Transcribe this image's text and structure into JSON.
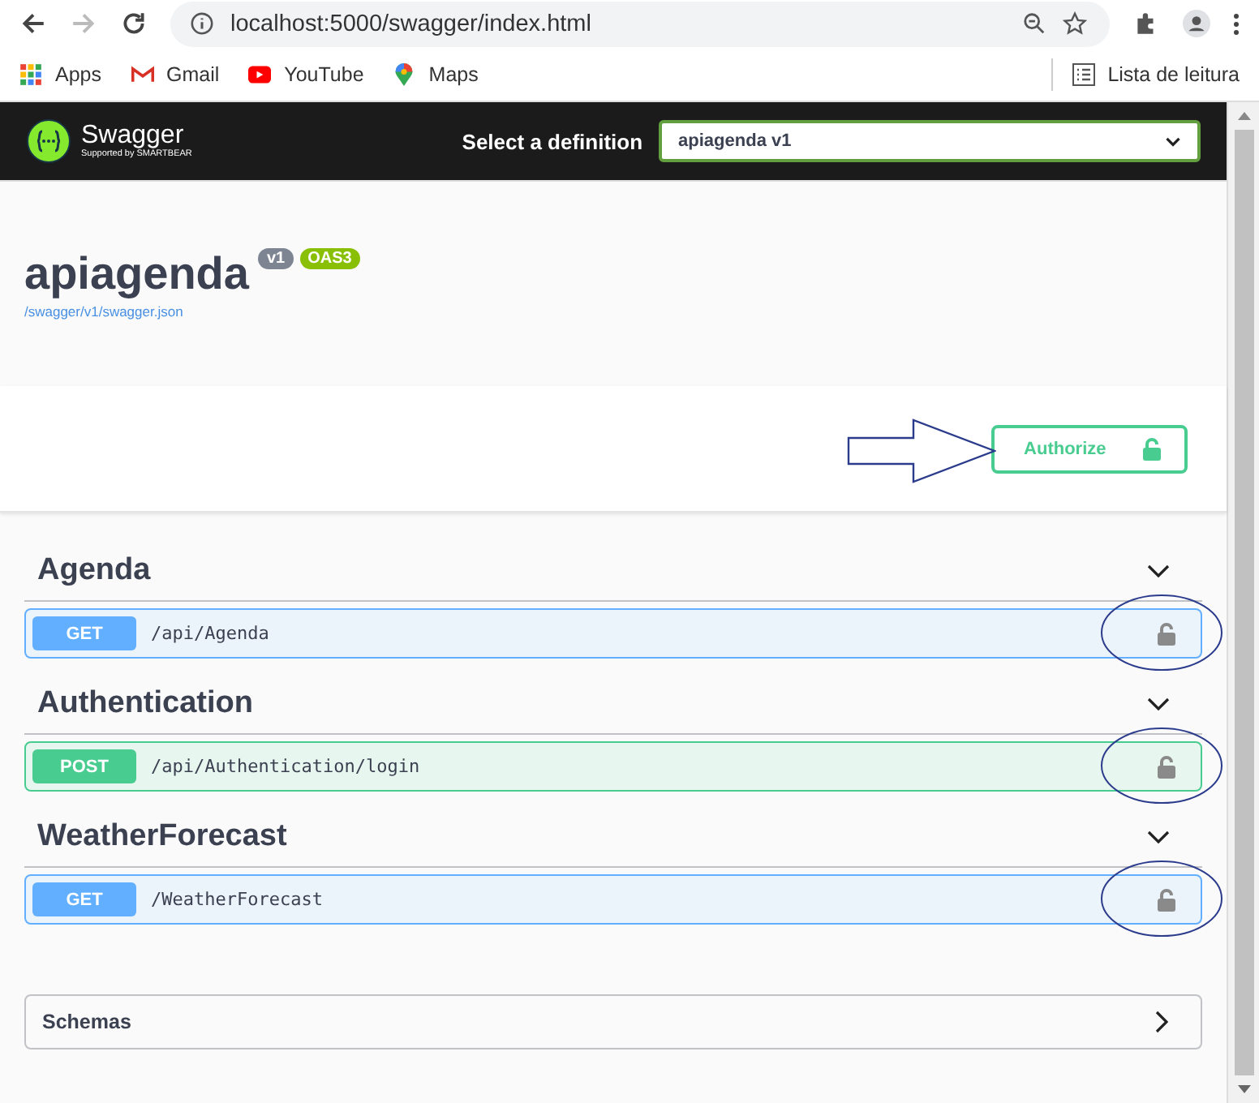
{
  "browser": {
    "url": "localhost:5000/swagger/index.html",
    "bookmarks": [
      {
        "label": "Apps",
        "kind": "apps"
      },
      {
        "label": "Gmail",
        "kind": "gmail"
      },
      {
        "label": "YouTube",
        "kind": "youtube"
      },
      {
        "label": "Maps",
        "kind": "maps"
      }
    ],
    "reading_list": "Lista de leitura"
  },
  "topbar": {
    "logo": "Swagger",
    "logo_sub": "Supported by SMARTBEAR",
    "select_label": "Select a definition",
    "definition": "apiagenda v1"
  },
  "info": {
    "title": "apiagenda",
    "badges": [
      {
        "label": "v1",
        "color": "#7d8492"
      },
      {
        "label": "OAS3",
        "color": "#89bf04"
      }
    ],
    "link": "/swagger/v1/swagger.json"
  },
  "authorize": {
    "label": "Authorize"
  },
  "tags": [
    {
      "name": "Agenda",
      "expanded": true,
      "operations": [
        {
          "method": "GET",
          "path": "/api/Agenda"
        }
      ]
    },
    {
      "name": "Authentication",
      "expanded": true,
      "operations": [
        {
          "method": "POST",
          "path": "/api/Authentication/login"
        }
      ]
    },
    {
      "name": "WeatherForecast",
      "expanded": true,
      "operations": [
        {
          "method": "GET",
          "path": "/WeatherForecast"
        }
      ]
    }
  ],
  "schemas": {
    "label": "Schemas",
    "expanded": false
  }
}
